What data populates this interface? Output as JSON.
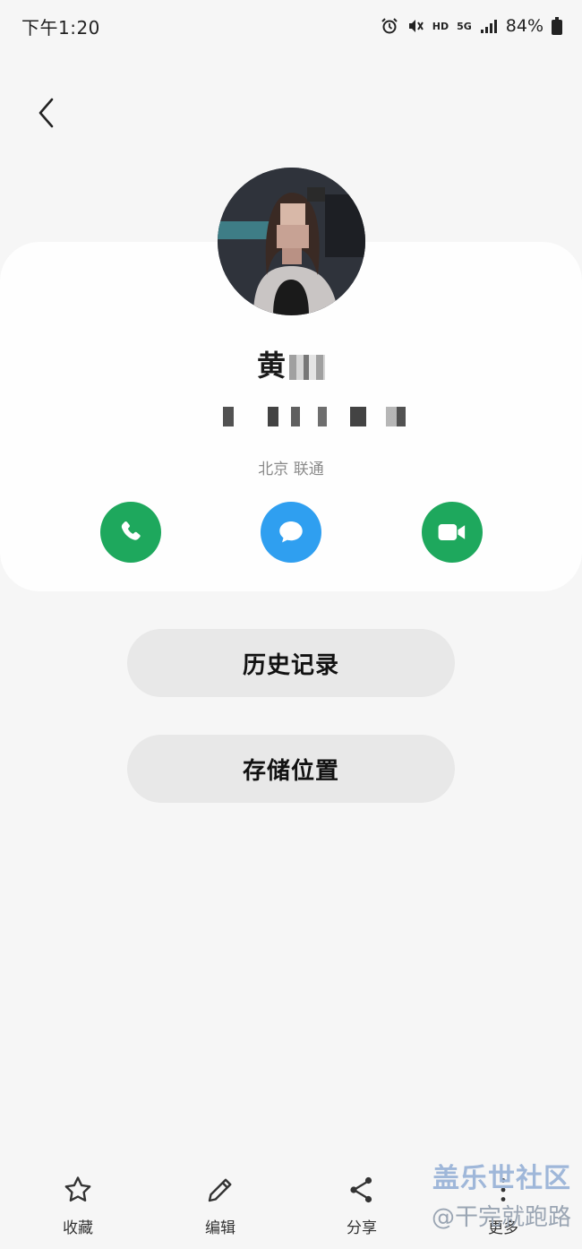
{
  "status_bar": {
    "time": "下午1:20",
    "hd": "HD",
    "net": "5G",
    "battery": "84%",
    "icons": [
      "alarm-icon",
      "mute-icon",
      "signal-icon",
      "battery-icon"
    ]
  },
  "nav": {
    "back_icon": "chevron-left-icon"
  },
  "contact": {
    "name": "黄",
    "carrier": "北京 联通"
  },
  "actions": {
    "call_icon": "phone-icon",
    "message_icon": "chat-bubble-icon",
    "video_icon": "video-camera-icon",
    "colors": {
      "call": "#1ea85d",
      "message": "#2f9ff0",
      "video": "#1ea85d"
    }
  },
  "buttons": {
    "history": "历史记录",
    "storage": "存储位置"
  },
  "bottom_bar": {
    "favorite": "收藏",
    "edit": "编辑",
    "share": "分享",
    "more": "更多"
  },
  "watermark": {
    "title": "盖乐世社区",
    "sub": "@干完就跑路"
  }
}
